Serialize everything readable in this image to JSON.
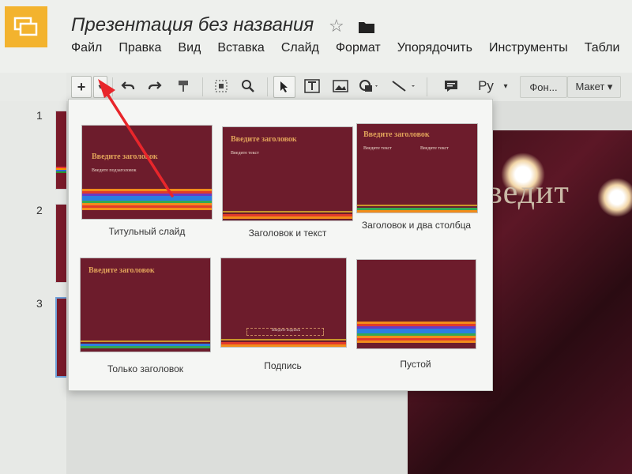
{
  "header": {
    "title": "Презентация без названия",
    "app_icon": "slides-logo-icon",
    "star_icon": "star-icon",
    "folder_icon": "folder-icon"
  },
  "menu": {
    "items": [
      "Файл",
      "Правка",
      "Вид",
      "Вставка",
      "Слайд",
      "Формат",
      "Упорядочить",
      "Инструменты",
      "Табли"
    ]
  },
  "toolbar": {
    "new_slide_label": "+",
    "language_label": "Ру",
    "background_label": "Фон...",
    "layout_label": "Макет ▾"
  },
  "filmstrip": {
    "numbers": [
      "1",
      "2",
      "3"
    ]
  },
  "main_slide": {
    "title": "ведит"
  },
  "layouts": [
    {
      "label": "Титульный слайд",
      "thumb_title": "Введите заголовок",
      "thumb_sub": "Введите подзаголовок"
    },
    {
      "label": "Заголовок и текст",
      "thumb_title": "Введите заголовок",
      "thumb_sub": "Введите текст"
    },
    {
      "label": "Заголовок и два столбца",
      "thumb_title": "Введите заголовок",
      "thumb_sub": "Введите текст",
      "thumb_sub2": "Введите текст"
    },
    {
      "label": "Только заголовок",
      "thumb_title": "Введите заголовок"
    },
    {
      "label": "Подпись",
      "thumb_sub": "Введите подпись"
    },
    {
      "label": "Пустой"
    }
  ],
  "colors": {
    "slide_bg": "#6d1c2c",
    "accent_title": "#e1a35a",
    "logo": "#f3b32e",
    "annotation_arrow": "#e8262b"
  }
}
